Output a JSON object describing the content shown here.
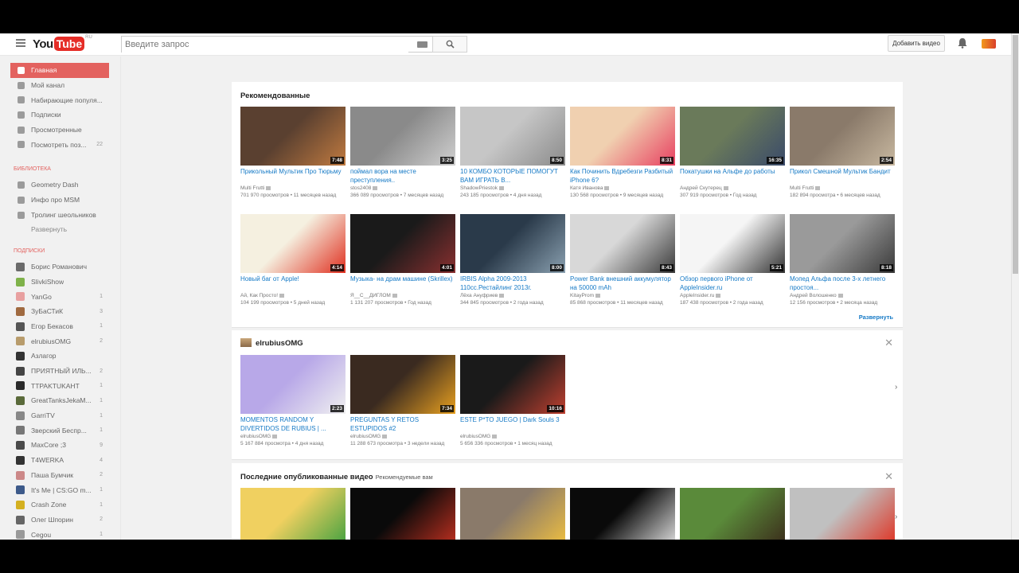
{
  "masthead": {
    "logo_you": "You",
    "logo_tube": "Tube",
    "logo_region": "RU",
    "search_placeholder": "Введите запрос",
    "upload_label": "Добавить видео"
  },
  "guide": {
    "main_items": [
      {
        "label": "Главная",
        "active": true,
        "icon": "home-icon"
      },
      {
        "label": "Мой канал",
        "icon": "person-icon"
      },
      {
        "label": "Набирающие популя...",
        "icon": "flame-icon"
      },
      {
        "label": "Подписки",
        "icon": "subscriptions-icon"
      },
      {
        "label": "Просмотренные",
        "icon": "history-icon"
      },
      {
        "label": "Посмотреть поз...",
        "count": "22",
        "icon": "watch-later-icon"
      }
    ],
    "library_heading": "БИБЛИОТЕКА",
    "library_items": [
      {
        "label": "Geometry Dash",
        "icon": "playlist-icon"
      },
      {
        "label": "Инфо про MSM",
        "icon": "playlist-icon"
      },
      {
        "label": "Тролинг шеольников",
        "icon": "playlist-icon"
      }
    ],
    "library_more": "Развернуть",
    "subs_heading": "ПОДПИСКИ",
    "subscriptions": [
      {
        "label": "Борис Романович",
        "count": "",
        "color": "#6b6b6b"
      },
      {
        "label": "SlivkiShow",
        "count": "",
        "color": "#7fb24a"
      },
      {
        "label": "YanGo",
        "count": "1",
        "color": "#e8a0a0"
      },
      {
        "label": "ЗуБаСТиК",
        "count": "3",
        "color": "#a06a40"
      },
      {
        "label": "Егор Бекасов",
        "count": "1",
        "color": "#555"
      },
      {
        "label": "elrubiusOMG",
        "count": "2",
        "color": "#b89c6c"
      },
      {
        "label": "Азлагор",
        "count": "",
        "color": "#333"
      },
      {
        "label": "ПРИЯТНЫЙ ИЛЬ...",
        "count": "2",
        "color": "#444"
      },
      {
        "label": "TTPAKTUKAHT",
        "count": "1",
        "color": "#2a2a2a"
      },
      {
        "label": "GreatTanksJekaM...",
        "count": "1",
        "color": "#5a6a3a"
      },
      {
        "label": "GarriTV",
        "count": "1",
        "color": "#888"
      },
      {
        "label": "Зверский Беспр...",
        "count": "1",
        "color": "#777"
      },
      {
        "label": "MaxCore ;3",
        "count": "9",
        "color": "#4a4a4a"
      },
      {
        "label": "T4WERKA",
        "count": "4",
        "color": "#333"
      },
      {
        "label": "Паша Бумчик",
        "count": "2",
        "color": "#c88"
      },
      {
        "label": "It's Me | CS:GO m...",
        "count": "1",
        "color": "#3d5a8a"
      },
      {
        "label": "Crash Zone",
        "count": "1",
        "color": "#d4b020"
      },
      {
        "label": "Олег Шпорин",
        "count": "2",
        "color": "#666"
      },
      {
        "label": "Cegou",
        "count": "1",
        "color": "#999"
      }
    ]
  },
  "recommended": {
    "title": "Рекомендованные",
    "expand": "Развернуть",
    "videos": [
      {
        "title": "Прикольный Мультик Про Тюрьму",
        "channel": "Multi Frutti",
        "views": "701 970 просмотров",
        "age": "11 месяцев назад",
        "duration": "7:48",
        "colors": [
          "#5a4030",
          "#c07a40"
        ]
      },
      {
        "title": "поймал вора на месте преступления..",
        "channel": "stos2408",
        "views": "366 089 просмотров",
        "age": "7 месяцев назад",
        "duration": "3:25",
        "colors": [
          "#8a8a8a",
          "#d0d0d0"
        ]
      },
      {
        "title": "10 КОМБО КОТОРЫЕ ПОМОГУТ ВАМ ИГРАТЬ В...",
        "channel": "ShadowPriestok",
        "views": "243 185 просмотров",
        "age": "4 дня назад",
        "duration": "8:50",
        "colors": [
          "#c6c6c6",
          "#8b8b8b"
        ]
      },
      {
        "title": "Как Починить Вдребезги Разбитый iPhone 6?",
        "channel": "Катя Иванова",
        "views": "130 568 просмотров",
        "age": "9 месяцев назад",
        "duration": "8:31",
        "colors": [
          "#f0d0b0",
          "#e84060"
        ]
      },
      {
        "title": "Покатушки на Альфе до работы",
        "channel": "Андрей Скутерец",
        "views": "307 919 просмотров",
        "age": "Год назад",
        "duration": "16:35",
        "colors": [
          "#6a7a5a",
          "#3a4a6a"
        ]
      },
      {
        "title": "Прикол Смешной Мультик Бандит",
        "channel": "Multi Frutti",
        "views": "182 894 просмотра",
        "age": "6 месяцев назад",
        "duration": "2:54",
        "colors": [
          "#8a7a6a",
          "#c8b8a0"
        ]
      },
      {
        "title": "Новый баг от Apple!",
        "channel": "Ай, Как Просто!",
        "views": "104 199 просмотров",
        "age": "5 дней назад",
        "duration": "4:14",
        "colors": [
          "#f5f0e0",
          "#e03020"
        ]
      },
      {
        "title": "Музыка- на драм машине (Skrillex)",
        "channel": "Я__С__ДИГЛОМ",
        "views": "1 131 207 просмотров",
        "age": "Год назад",
        "duration": "4:01",
        "colors": [
          "#1a1a1a",
          "#8a3030"
        ]
      },
      {
        "title": "IRBIS Alpha 2009-2013 110cc.Рестайлинг 2013г.",
        "channel": "Лёха Ануфриев",
        "views": "344 845 просмотров",
        "age": "2 года назад",
        "duration": "8:00",
        "colors": [
          "#2a3a4a",
          "#8aa0b0"
        ]
      },
      {
        "title": "Power Bank внешний аккумулятор на 50000 mAh",
        "channel": "KitayProm",
        "views": "85 868 просмотров",
        "age": "11 месяцев назад",
        "duration": "8:43",
        "colors": [
          "#d8d8d8",
          "#3a3a3a"
        ]
      },
      {
        "title": "Обзор первого iPhone от AppleInsider.ru",
        "channel": "AppleInsider.ru",
        "views": "187 438 просмотров",
        "age": "2 года назад",
        "duration": "5:21",
        "colors": [
          "#f5f5f5",
          "#333333"
        ]
      },
      {
        "title": "Мопед Альфа после 3-х летнего простоя...",
        "channel": "Андрей Волошенко",
        "views": "12 156 просмотров",
        "age": "2 месяца назад",
        "duration": "8:18",
        "colors": [
          "#9a9a9a",
          "#3a3a3a"
        ]
      }
    ]
  },
  "channel_shelf": {
    "title": "elrubiusOMG",
    "videos": [
      {
        "title": "MOMENTOS RANDOM Y DIVERTIDOS DE RUBIUS | ...",
        "channel": "elrubiusOMG",
        "views": "5 167 884 просмотра",
        "age": "4 дня назад",
        "duration": "2:23",
        "colors": [
          "#b8a8e8",
          "#f0f0f0"
        ]
      },
      {
        "title": "PREGUNTAS Y RETOS ESTUPIDOS #2",
        "channel": "elrubiusOMG",
        "views": "11 288 673 просмотра",
        "age": "3 недели назад",
        "duration": "7:34",
        "colors": [
          "#3a2a20",
          "#e8a020"
        ]
      },
      {
        "title": "ESTE P*TO JUEGO | Dark Souls 3",
        "channel": "elrubiusOMG",
        "views": "5 656 336 просмотров",
        "age": "1 месяц назад",
        "duration": "10:16",
        "colors": [
          "#1a1a1a",
          "#c04030"
        ]
      }
    ]
  },
  "latest_shelf": {
    "title": "Последние опубликованные видео",
    "subtitle": "Рекомендуемые вам",
    "videos": [
      {
        "colors": [
          "#f0d060",
          "#40a040"
        ]
      },
      {
        "colors": [
          "#0a0a0a",
          "#c03020"
        ]
      },
      {
        "colors": [
          "#8a7a6a",
          "#f0c040"
        ]
      },
      {
        "colors": [
          "#0a0a0a",
          "#e0e0e0"
        ]
      },
      {
        "colors": [
          "#5a8a3a",
          "#3a2a1a"
        ]
      },
      {
        "colors": [
          "#c0c0c0",
          "#e03020"
        ]
      }
    ]
  }
}
